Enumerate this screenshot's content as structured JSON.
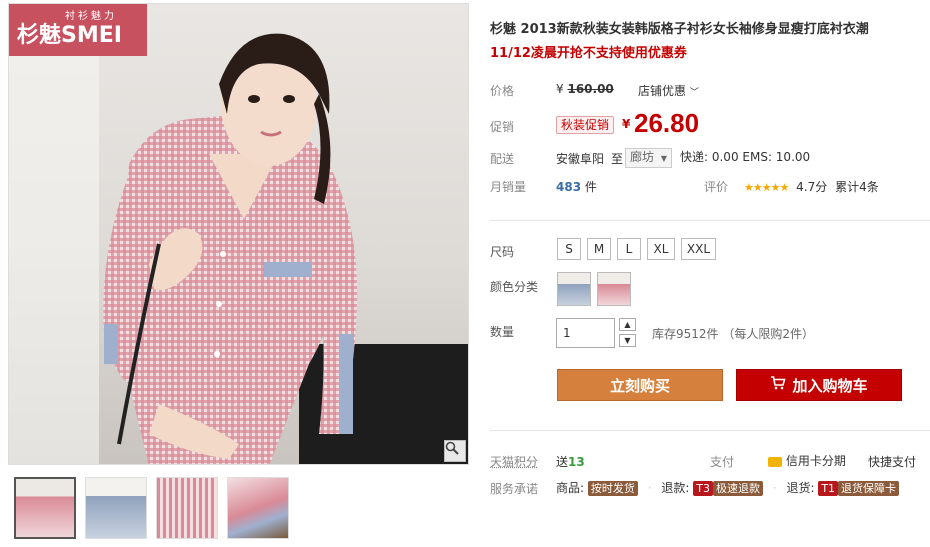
{
  "brand": {
    "logo_top": "衬衫魅力",
    "logo_main": "杉魅SMEI"
  },
  "product": {
    "title": "杉魅 2013新款秋装女装韩版格子衬衫女长袖修身显瘦打底衬衣潮",
    "promo_line": "11/12凌晨开抢不支持使用优惠券"
  },
  "price": {
    "label": "价格",
    "currency": "¥",
    "original": "160.00",
    "store_discount": "店铺优惠",
    "promo_label": "促销",
    "promo_tag": "秋装促销",
    "promo_price": "26.80"
  },
  "shipping": {
    "label": "配送",
    "from": "安徽阜阳",
    "to_word": "至",
    "destination": "廊坊",
    "fees": "快递: 0.00 EMS: 10.00"
  },
  "sales": {
    "label": "月销量",
    "count": "483",
    "unit": "件",
    "rating_label": "评价",
    "stars": "★★★★★",
    "score": "4.7分",
    "reviews": "累计4条"
  },
  "sku": {
    "size_label": "尺码",
    "sizes": [
      "S",
      "M",
      "L",
      "XL",
      "XXL"
    ],
    "color_label": "颜色分类",
    "quantity_label": "数量",
    "quantity_value": "1",
    "stock_info": "库存9512件 （每人限购2件）"
  },
  "actions": {
    "buy_now": "立刻购买",
    "add_to_cart": "加入购物车"
  },
  "services": {
    "points_label": "天猫积分",
    "points_prefix": "送",
    "points_value": "13",
    "pay_label": "支付",
    "credit": "信用卡分期",
    "quick_pay": "快捷支付",
    "promise_label": "服务承诺",
    "goods_label": "商品:",
    "goods_badge": "按时发货",
    "refund_label": "退款:",
    "refund_code": "T3",
    "refund_badge": "极速退款",
    "return_label": "退货:",
    "return_code": "T1",
    "return_badge": "退货保障卡"
  },
  "colors": {
    "accent_red": "#c40000",
    "buy_orange": "#d5813d",
    "logo_pink": "#c8515f"
  }
}
